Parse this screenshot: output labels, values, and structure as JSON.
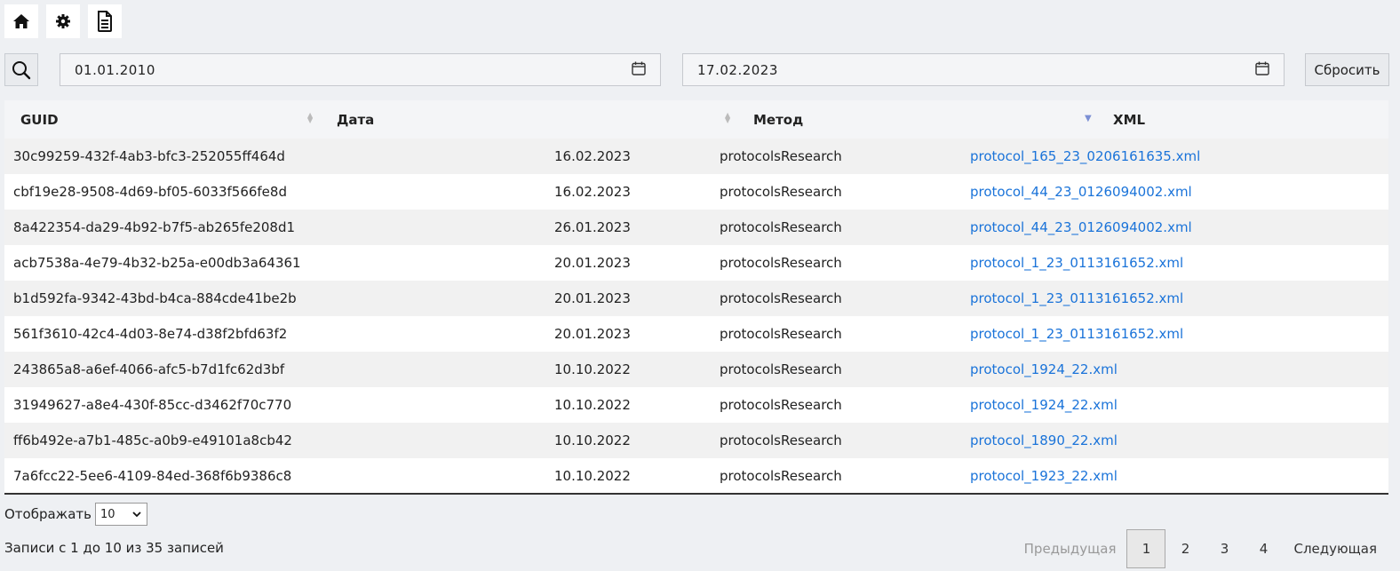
{
  "toolbar": {
    "icons": [
      "home-icon",
      "gear-icon",
      "document-icon"
    ]
  },
  "filters": {
    "search_icon": "search-icon",
    "date_from": "01.01.2010",
    "date_to": "17.02.2023",
    "calendar_icon": "calendar-icon",
    "reset_label": "Сбросить"
  },
  "table": {
    "columns": [
      "GUID",
      "Дата",
      "Метод",
      "XML"
    ],
    "sort": {
      "column": "XML",
      "direction": "desc"
    },
    "rows": [
      {
        "guid": "30c99259-432f-4ab3-bfc3-252055ff464d",
        "date": "16.02.2023",
        "method": "protocolsResearch",
        "xml": "protocol_165_23_0206161635.xml"
      },
      {
        "guid": "cbf19e28-9508-4d69-bf05-6033f566fe8d",
        "date": "16.02.2023",
        "method": "protocolsResearch",
        "xml": "protocol_44_23_0126094002.xml"
      },
      {
        "guid": "8a422354-da29-4b92-b7f5-ab265fe208d1",
        "date": "26.01.2023",
        "method": "protocolsResearch",
        "xml": "protocol_44_23_0126094002.xml"
      },
      {
        "guid": "acb7538a-4e79-4b32-b25a-e00db3a64361",
        "date": "20.01.2023",
        "method": "protocolsResearch",
        "xml": "protocol_1_23_0113161652.xml"
      },
      {
        "guid": "b1d592fa-9342-43bd-b4ca-884cde41be2b",
        "date": "20.01.2023",
        "method": "protocolsResearch",
        "xml": "protocol_1_23_0113161652.xml"
      },
      {
        "guid": "561f3610-42c4-4d03-8e74-d38f2bfd63f2",
        "date": "20.01.2023",
        "method": "protocolsResearch",
        "xml": "protocol_1_23_0113161652.xml"
      },
      {
        "guid": "243865a8-a6ef-4066-afc5-b7d1fc62d3bf",
        "date": "10.10.2022",
        "method": "protocolsResearch",
        "xml": "protocol_1924_22.xml"
      },
      {
        "guid": "31949627-a8e4-430f-85cc-d3462f70c770",
        "date": "10.10.2022",
        "method": "protocolsResearch",
        "xml": "protocol_1924_22.xml"
      },
      {
        "guid": "ff6b492e-a7b1-485c-a0b9-e49101a8cb42",
        "date": "10.10.2022",
        "method": "protocolsResearch",
        "xml": "protocol_1890_22.xml"
      },
      {
        "guid": "7a6fcc22-5ee6-4109-84ed-368f6b9386c8",
        "date": "10.10.2022",
        "method": "protocolsResearch",
        "xml": "protocol_1923_22.xml"
      }
    ]
  },
  "length_menu": {
    "label": "Отображать",
    "value": "10"
  },
  "info": "Записи с 1 до 10 из 35 записей",
  "pagination": {
    "prev": "Предыдущая",
    "pages": [
      "1",
      "2",
      "3",
      "4"
    ],
    "current": "1",
    "next": "Следующая"
  },
  "colors": {
    "link": "#1a73d9",
    "sort_active": "#7b8fd4",
    "background": "#eef0f3"
  }
}
